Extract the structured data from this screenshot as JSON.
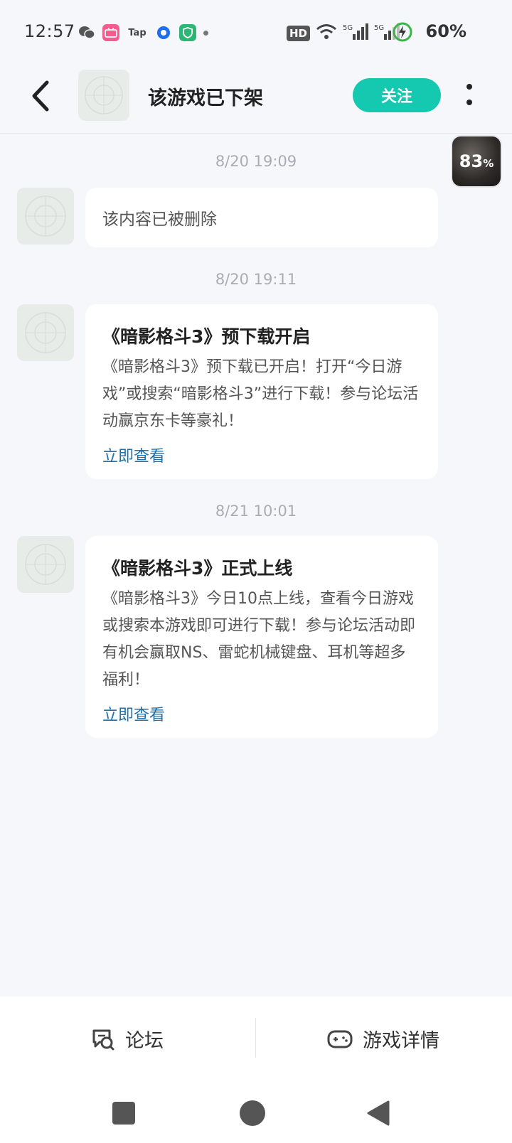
{
  "status_bar": {
    "time": "12:57",
    "tap_label": "Tap",
    "hd_label": "HD",
    "battery": "60%"
  },
  "header": {
    "title": "该游戏已下架",
    "follow_label": "关注"
  },
  "floating_badge": {
    "value": "83",
    "unit": "%"
  },
  "messages": [
    {
      "timestamp": "8/20  19:09",
      "text": "该内容已被删除"
    },
    {
      "timestamp": "8/20  19:11",
      "title": "《暗影格斗3》预下载开启",
      "body": "《暗影格斗3》预下载已开启！打开“今日游戏”或搜索“暗影格斗3”进行下载！参与论坛活动赢京东卡等豪礼！",
      "link": "立即查看"
    },
    {
      "timestamp": "8/21  10:01",
      "title": "《暗影格斗3》正式上线",
      "body": "《暗影格斗3》今日10点上线，查看今日游戏或搜索本游戏即可进行下载！参与论坛活动即有机会赢取NS、雷蛇机械键盘、耳机等超多福利！",
      "link": "立即查看"
    }
  ],
  "bottom_tabs": {
    "forum": "论坛",
    "game_details": "游戏详情"
  },
  "colors": {
    "accent": "#15c8b0",
    "link": "#1f6fa8",
    "background": "#f5f7fa"
  }
}
